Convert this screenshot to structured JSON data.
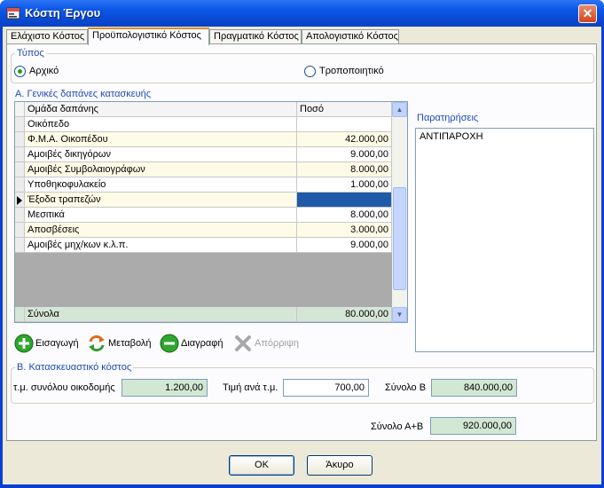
{
  "window": {
    "title": "Κόστη Έργου",
    "close_glyph": "✕"
  },
  "tabs": [
    {
      "label": "Ελάχιστο Κόστος",
      "active": false
    },
    {
      "label": "Προϋπολογιστικό Κόστος",
      "active": true
    },
    {
      "label": "Πραγματικό Κόστος",
      "active": false
    },
    {
      "label": "Απολογιστικό Κόστος",
      "active": false
    }
  ],
  "type_group": {
    "title": "Τύπος",
    "options": [
      {
        "label": "Αρχικό",
        "checked": true
      },
      {
        "label": "Τροποποιητικό",
        "checked": false
      }
    ]
  },
  "section_a": {
    "title": "Α. Γενικές δαπάνες κατασκευής",
    "columns": [
      "Ομάδα δαπάνης",
      "Ποσό"
    ],
    "rows": [
      {
        "group": "Οικόπεδο",
        "amount": ""
      },
      {
        "group": "Φ.Μ.Α. Οικοπέδου",
        "amount": "42.000,00"
      },
      {
        "group": "Αμοιβές δικηγόρων",
        "amount": "9.000,00"
      },
      {
        "group": "Αμοιβές Συμβολαιογράφων",
        "amount": "8.000,00"
      },
      {
        "group": "Υποθηκοφυλακείο",
        "amount": "1.000,00"
      },
      {
        "group": "Έξοδα τραπεζών",
        "amount": ""
      },
      {
        "group": "Μεσιτικά",
        "amount": "8.000,00"
      },
      {
        "group": "Αποσβέσεις",
        "amount": "3.000,00"
      },
      {
        "group": "Αμοιβές μηχ/κων κ.λ.π.",
        "amount": "9.000,00"
      }
    ],
    "current_row": 5,
    "totals_label": "Σύνολα",
    "totals_value": "80.000,00"
  },
  "notes": {
    "title": "Παρατηρήσεις",
    "text": "ΑΝΤΙΠΑΡΟΧΗ"
  },
  "toolbar": {
    "add": "Εισαγωγή",
    "edit": "Μεταβολή",
    "delete": "Διαγραφή",
    "cancel": "Απόρριψη"
  },
  "section_b": {
    "title": "Β. Κατασκευαστικό κόστος",
    "area_label": "τ.μ. συνόλου οικοδομής",
    "area_value": "1.200,00",
    "price_label": "Τιμή ανά τ.μ.",
    "price_value": "700,00",
    "total_b_label": "Σύνολο Β",
    "total_b_value": "840.000,00"
  },
  "total_ab": {
    "label": "Σύνολο Α+Β",
    "value": "920.000,00"
  },
  "buttons": {
    "ok": "OK",
    "cancel": "Άκυρο"
  },
  "colors": {
    "title_bar": "#0c58e8",
    "client": "#ece9d8",
    "selected_cell": "#1f5aa8",
    "readonly_field": "#d2e8d2",
    "odd_row": "#fffbe6"
  }
}
